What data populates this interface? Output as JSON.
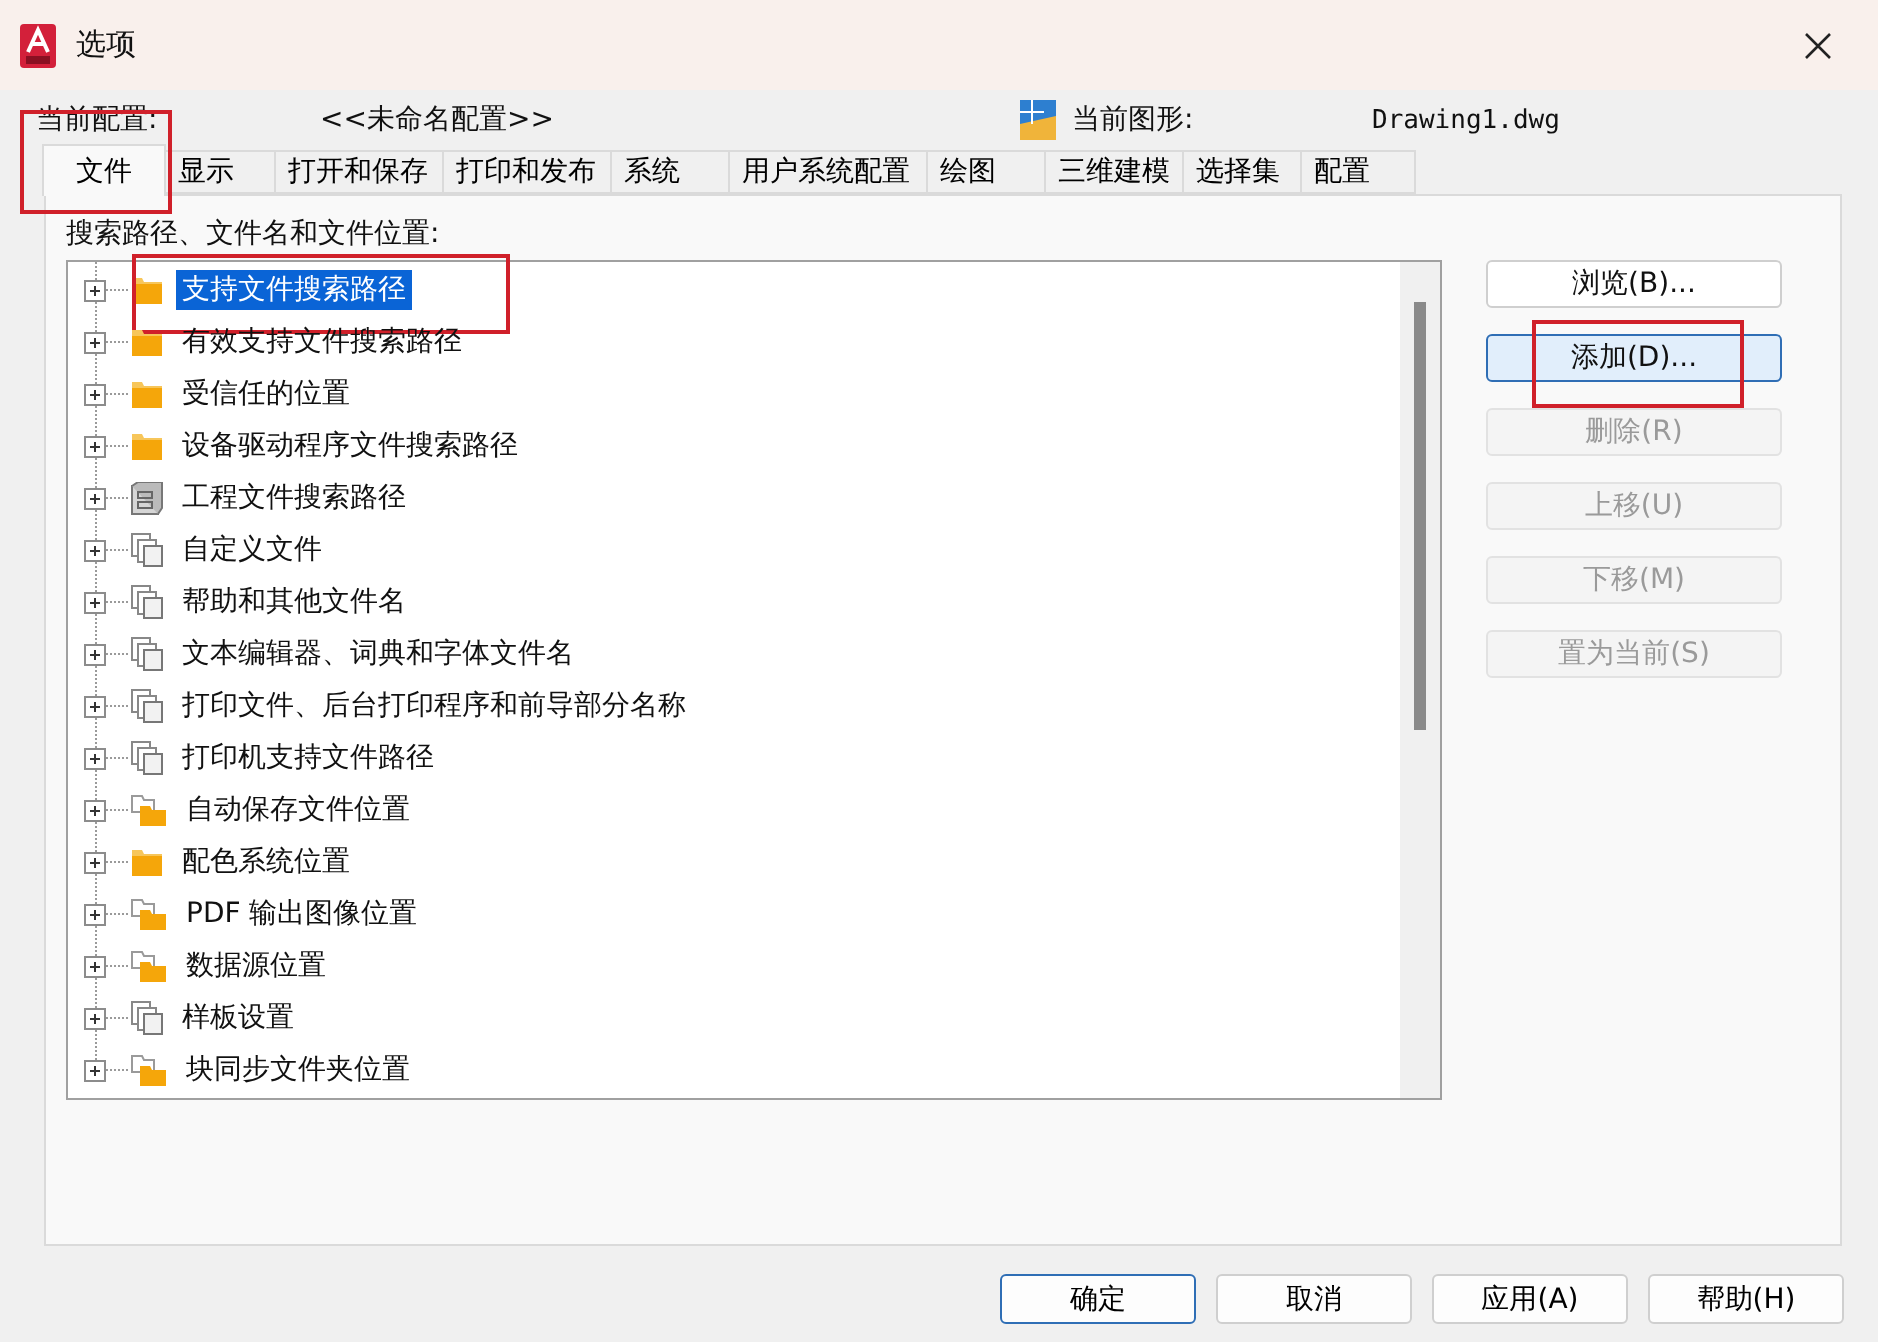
{
  "window": {
    "title": "选项"
  },
  "profile": {
    "label": "当前配置:",
    "value": "<<未命名配置>>",
    "drawing_label": "当前图形:",
    "drawing_value": "Drawing1.dwg"
  },
  "tabs": [
    {
      "label": "文件",
      "selected": true,
      "marked": true
    },
    {
      "label": "显示",
      "selected": false,
      "marked": false
    },
    {
      "label": "打开和保存",
      "selected": false,
      "marked": false
    },
    {
      "label": "打印和发布",
      "selected": false,
      "marked": false
    },
    {
      "label": "系统",
      "selected": false,
      "marked": false
    },
    {
      "label": "用户系统配置",
      "selected": false,
      "marked": false
    },
    {
      "label": "绘图",
      "selected": false,
      "marked": false
    },
    {
      "label": "三维建模",
      "selected": false,
      "marked": false
    },
    {
      "label": "选择集",
      "selected": false,
      "marked": false
    },
    {
      "label": "配置",
      "selected": false,
      "marked": false
    }
  ],
  "tree": {
    "label": "搜索路径、文件名和文件位置:",
    "items": [
      {
        "label": "支持文件搜索路径",
        "kind": "folder",
        "selected": true,
        "marked": true
      },
      {
        "label": "有效支持文件搜索路径",
        "kind": "folder",
        "selected": false,
        "marked": false
      },
      {
        "label": "受信任的位置",
        "kind": "folder",
        "selected": false,
        "marked": false
      },
      {
        "label": "设备驱动程序文件搜索路径",
        "kind": "folder",
        "selected": false,
        "marked": false
      },
      {
        "label": "工程文件搜索路径",
        "kind": "cabinet",
        "selected": false,
        "marked": false
      },
      {
        "label": "自定义文件",
        "kind": "pages",
        "selected": false,
        "marked": false
      },
      {
        "label": "帮助和其他文件名",
        "kind": "pages",
        "selected": false,
        "marked": false
      },
      {
        "label": "文本编辑器、词典和字体文件名",
        "kind": "pages",
        "selected": false,
        "marked": false
      },
      {
        "label": "打印文件、后台打印程序和前导部分名称",
        "kind": "pages",
        "selected": false,
        "marked": false
      },
      {
        "label": "打印机支持文件路径",
        "kind": "pages",
        "selected": false,
        "marked": false
      },
      {
        "label": "自动保存文件位置",
        "kind": "location",
        "selected": false,
        "marked": false
      },
      {
        "label": "配色系统位置",
        "kind": "folder",
        "selected": false,
        "marked": false
      },
      {
        "label": "PDF 输出图像位置",
        "kind": "location",
        "selected": false,
        "marked": false
      },
      {
        "label": "数据源位置",
        "kind": "location",
        "selected": false,
        "marked": false
      },
      {
        "label": "样板设置",
        "kind": "pages",
        "selected": false,
        "marked": false
      },
      {
        "label": "块同步文件夹位置",
        "kind": "location",
        "selected": false,
        "marked": false
      }
    ]
  },
  "side_buttons": [
    {
      "label": "浏览(B)...",
      "disabled": false,
      "focused": false,
      "marked": false
    },
    {
      "label": "添加(D)...",
      "disabled": false,
      "focused": true,
      "marked": true
    },
    {
      "label": "删除(R)",
      "disabled": true,
      "focused": false,
      "marked": false
    },
    {
      "label": "上移(U)",
      "disabled": true,
      "focused": false,
      "marked": false
    },
    {
      "label": "下移(M)",
      "disabled": true,
      "focused": false,
      "marked": false
    },
    {
      "label": "置为当前(S)",
      "disabled": true,
      "focused": false,
      "marked": false
    }
  ],
  "footer_buttons": [
    {
      "label": "确定",
      "default": true
    },
    {
      "label": "取消",
      "default": false
    },
    {
      "label": "应用(A)",
      "default": false
    },
    {
      "label": "帮助(H)",
      "default": false
    }
  ]
}
